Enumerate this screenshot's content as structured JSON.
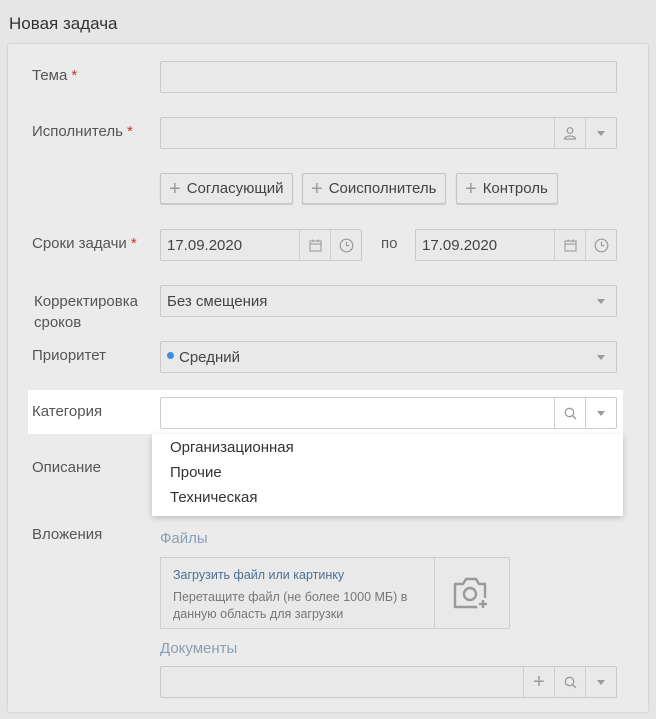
{
  "window_title": "Новая задача",
  "form": {
    "subject": {
      "label": "Тема",
      "required_mark": "*",
      "value": ""
    },
    "assignee": {
      "label": "Исполнитель",
      "required_mark": "*",
      "value": "",
      "icon": "user-icon"
    },
    "extra_buttons": [
      "Согласующий",
      "Соисполнитель",
      "Контроль"
    ],
    "deadline": {
      "label": "Сроки задачи",
      "required_mark": "*",
      "start": "17.09.2020",
      "separator": "по",
      "end": "17.09.2020"
    },
    "adjust": {
      "label_line1": "Корректировка",
      "label_line2": "сроков",
      "value": "Без смещения"
    },
    "priority": {
      "label": "Приоритет",
      "value": "Средний",
      "dot_color": "#3a8ee6"
    },
    "category": {
      "label": "Категория",
      "value": "",
      "options": [
        "Организационная",
        "Прочие",
        "Техническая"
      ]
    },
    "description": {
      "label": "Описание"
    },
    "attachments": {
      "label": "Вложения",
      "files_label": "Файлы",
      "upload_link": "Загрузить файл или картинку",
      "upload_hint": "Перетащите файл (не более 1000 МБ) в данную область для загрузки",
      "documents_label": "Документы"
    }
  }
}
